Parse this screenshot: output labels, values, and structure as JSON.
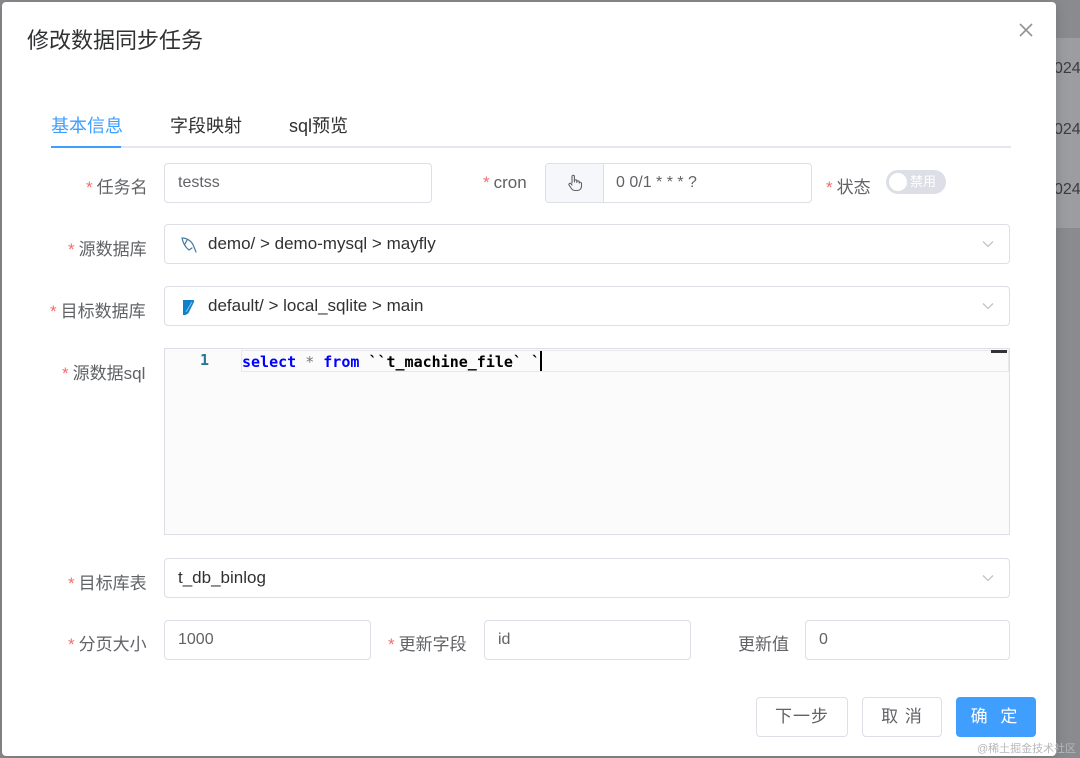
{
  "background": {
    "row_fragments": [
      "024",
      "024",
      "024"
    ]
  },
  "dialog": {
    "title": "修改数据同步任务",
    "close_icon": "close-icon"
  },
  "tabs": [
    {
      "label": "基本信息",
      "active": true
    },
    {
      "label": "字段映射",
      "active": false
    },
    {
      "label": "sql预览",
      "active": false
    }
  ],
  "form": {
    "required_mark": "*",
    "task_name": {
      "label": "任务名",
      "value": "testss"
    },
    "cron": {
      "label": "cron",
      "value": "0 0/1 * * * ?",
      "icon": "hand-pointer-icon"
    },
    "status": {
      "label": "状态",
      "switch_text": "禁用",
      "on": false
    },
    "source_db": {
      "label": "源数据库",
      "value": "demo/ > demo-mysql > mayfly",
      "icon": "mysql-dolphin-icon"
    },
    "target_db": {
      "label": "目标数据库",
      "value": "default/ > local_sqlite > main",
      "icon": "sqlite-feather-icon"
    },
    "source_sql": {
      "label": "源数据sql",
      "line_number": "1",
      "code_keyword_1": "select",
      "code_op": "*",
      "code_keyword_2": "from",
      "code_rest": "``t_machine_file` `"
    },
    "target_table": {
      "label": "目标库表",
      "value": "t_db_binlog"
    },
    "page_size": {
      "label": "分页大小",
      "value": "1000"
    },
    "update_field": {
      "label": "更新字段",
      "value": "id"
    },
    "update_value": {
      "label": "更新值",
      "value": "0"
    }
  },
  "footer": {
    "next_label": "下一步",
    "cancel_label": "取 消",
    "confirm_label": "确 定"
  },
  "watermark": "@稀土掘金技术社区",
  "colors": {
    "primary": "#409eff",
    "required": "#f56c6c",
    "border": "#dcdfe6"
  }
}
